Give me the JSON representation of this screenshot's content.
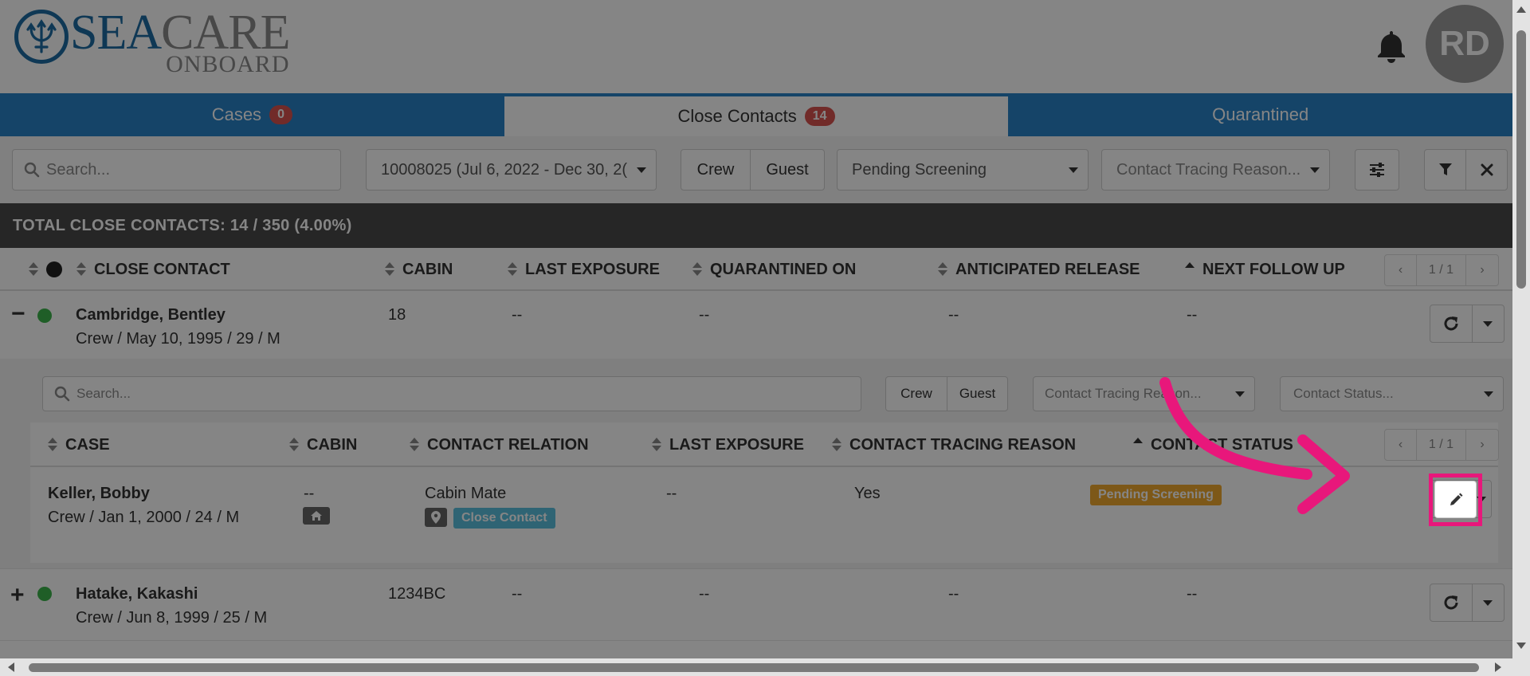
{
  "header": {
    "logo": {
      "sea": "SEA",
      "care": "CARE",
      "onboard": "ONBOARD"
    },
    "avatar_initials": "RD"
  },
  "tabs": [
    {
      "label": "Cases",
      "badge": "0"
    },
    {
      "label": "Close Contacts",
      "badge": "14"
    },
    {
      "label": "Quarantined",
      "badge": ""
    }
  ],
  "filters": {
    "search_placeholder": "Search...",
    "voyage": "10008025 (Jul 6, 2022 - Dec 30, 2(",
    "crew_label": "Crew",
    "guest_label": "Guest",
    "status": "Pending Screening",
    "reason_placeholder": "Contact Tracing Reason..."
  },
  "totals": "TOTAL CLOSE CONTACTS: 14 / 350 (4.00%)",
  "columns": [
    "CLOSE CONTACT",
    "CABIN",
    "LAST EXPOSURE",
    "QUARANTINED ON",
    "ANTICIPATED RELEASE",
    "NEXT FOLLOW UP"
  ],
  "pager": "1 / 1",
  "rows": [
    {
      "name": "Cambridge, Bentley",
      "details": "Crew / May 10, 1995 / 29 / M",
      "cabin": "18",
      "last_exposure": "--",
      "quarantined_on": "--",
      "anticipated_release": "--",
      "next_follow_up": "--",
      "expander": "−"
    },
    {
      "name": "Hatake, Kakashi",
      "details": "Crew / Jun 8, 1999 / 25 / M",
      "cabin": "1234BC",
      "last_exposure": "--",
      "quarantined_on": "--",
      "anticipated_release": "--",
      "next_follow_up": "--",
      "expander": "+"
    }
  ],
  "subtable": {
    "search_placeholder": "Search...",
    "crew_label": "Crew",
    "guest_label": "Guest",
    "reason_placeholder": "Contact Tracing Reason...",
    "status_placeholder": "Contact Status...",
    "columns": [
      "CASE",
      "CABIN",
      "CONTACT RELATION",
      "LAST EXPOSURE",
      "CONTACT TRACING REASON",
      "CONTACT STATUS"
    ],
    "pager": "1 / 1",
    "row": {
      "name": "Keller, Bobby",
      "details": "Crew / Jan 1, 2000 / 24 / M",
      "cabin": "--",
      "relation": "Cabin Mate",
      "relation_tag": "Close Contact",
      "last_exposure": "--",
      "reason": "Yes",
      "status_tag": "Pending Screening"
    }
  },
  "colors": {
    "brand_blue": "#1d6ca3",
    "tab_blue": "#2a82c8",
    "highlight": "#e8177b",
    "status_green": "#3cb44b",
    "pending_orange": "#f0a92e",
    "tag_blue": "#5bc0de"
  }
}
